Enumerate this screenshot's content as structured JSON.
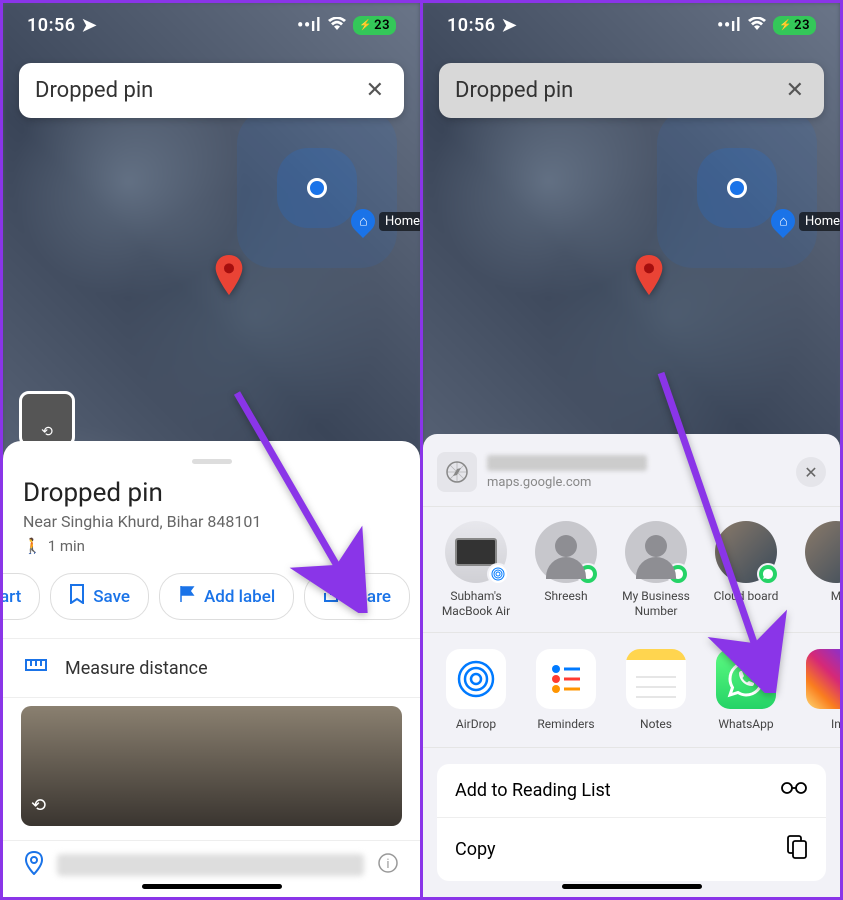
{
  "status": {
    "time": "10:56",
    "battery": "23"
  },
  "search": {
    "value": "Dropped pin"
  },
  "home_label": "Home",
  "sheet": {
    "title": "Dropped pin",
    "subtitle": "Near Singhia Khurd, Bihar 848101",
    "walk_time": "1 min",
    "actions": {
      "start": "art",
      "save": "Save",
      "add_label": "Add label",
      "share": "Share"
    },
    "measure": "Measure distance"
  },
  "share_sheet": {
    "domain": "maps.google.com",
    "contacts": [
      {
        "name": "Subham's MacBook Air",
        "type": "mac",
        "badge": "airdrop"
      },
      {
        "name": "Shreesh",
        "type": "person",
        "badge": "wa"
      },
      {
        "name": "My Business Number",
        "type": "person",
        "badge": "wa"
      },
      {
        "name": "Cloud board",
        "type": "photo",
        "badge": "wa"
      },
      {
        "name": "M",
        "type": "photo",
        "badge": ""
      }
    ],
    "apps": [
      {
        "name": "AirDrop"
      },
      {
        "name": "Reminders"
      },
      {
        "name": "Notes"
      },
      {
        "name": "WhatsApp"
      },
      {
        "name": "In"
      }
    ],
    "actions": [
      {
        "label": "Add to Reading List",
        "icon": "glasses"
      },
      {
        "label": "Copy",
        "icon": "copy"
      }
    ]
  }
}
